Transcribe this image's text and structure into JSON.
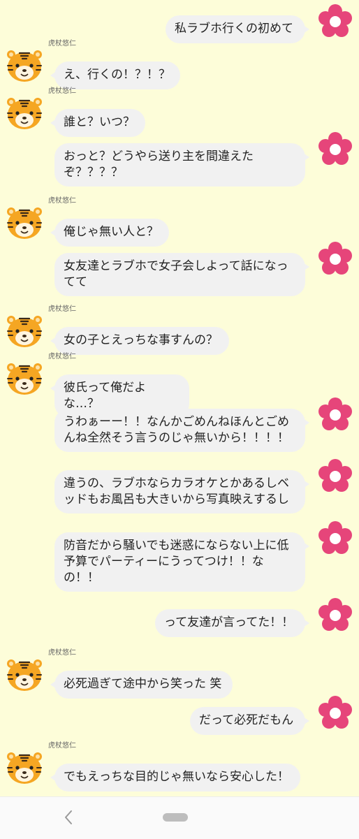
{
  "contact_name": "虎杖悠仁",
  "messages": [
    {
      "side": "right",
      "text": "私ラブホ行くの初めて"
    },
    {
      "side": "left",
      "text": "え、行くの！？！？"
    },
    {
      "side": "left",
      "text": "誰と？いつ？"
    },
    {
      "side": "right",
      "text": "おっと？どうやら送り主を間違えたぞ？？？？"
    },
    {
      "side": "left",
      "text": "俺じゃ無い人と？"
    },
    {
      "side": "right",
      "text": "女友達とラブホで女子会しよって話になってて"
    },
    {
      "side": "left",
      "text": "女の子とえっちな事すんの？"
    },
    {
      "side": "left",
      "text": "彼氏って俺だよな…？"
    },
    {
      "side": "right",
      "text": "うわぁーー！！なんかごめんねほんとごめんね全然そう言うのじゃ無いから！！！！"
    },
    {
      "side": "right",
      "text": "違うの、ラブホならカラオケとかあるしベッドもお風呂も大きいから写真映えするし"
    },
    {
      "side": "right",
      "text": "防音だから騒いでも迷惑にならない上に低予算でパーティーにうってつけ！！なの！！"
    },
    {
      "side": "right",
      "text": "って友達が言ってた！！"
    },
    {
      "side": "left",
      "text": "必死過ぎて途中から笑った 笑"
    },
    {
      "side": "right",
      "text": "だって必死だもん"
    },
    {
      "side": "left",
      "text": "でもえっちな目的じゃ無いなら安心した！"
    }
  ],
  "icons": {
    "self_avatar": "pink-flower-icon",
    "contact_avatar": "tiger-avatar-icon",
    "nav_back": "back-chevron-icon",
    "nav_home": "home-pill-icon"
  },
  "colors": {
    "background": "#fdfdd9",
    "bubble": "#f1f1f1",
    "flower": "#e6457a"
  }
}
